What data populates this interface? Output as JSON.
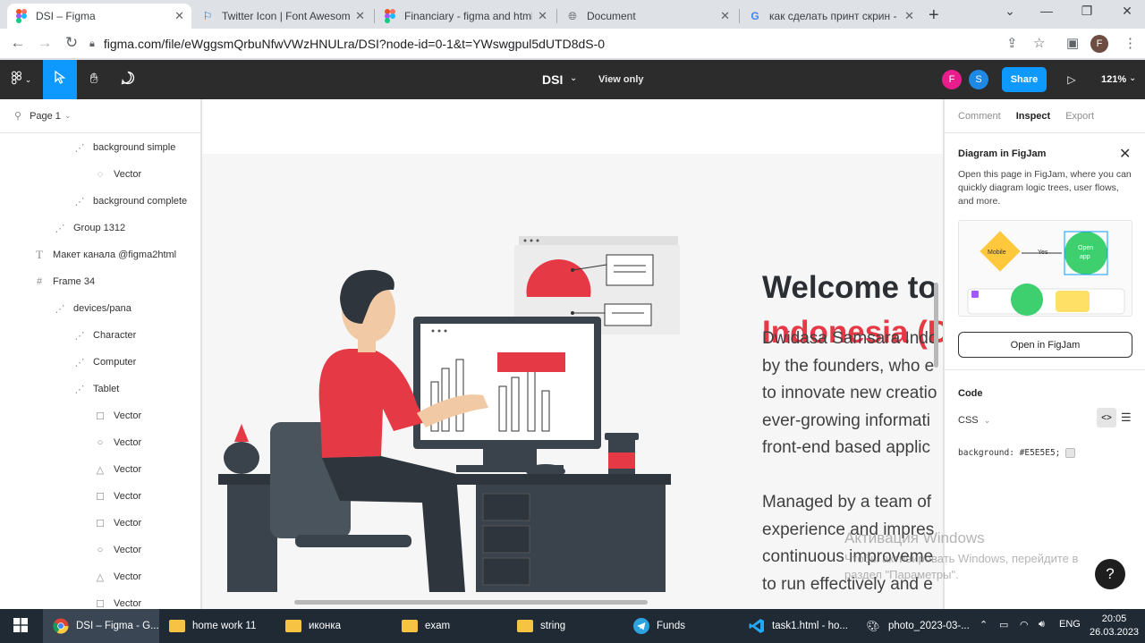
{
  "browser": {
    "tabs": [
      {
        "title": "DSI – Figma",
        "icon": "figma-icon",
        "active": true
      },
      {
        "title": "Twitter Icon | Font Awesome",
        "icon": "flag-icon",
        "active": false
      },
      {
        "title": "Financiary - figma and html f",
        "icon": "figma-icon",
        "active": false
      },
      {
        "title": "Document",
        "icon": "globe-icon",
        "active": false
      },
      {
        "title": "как сделать принт скрин - П",
        "icon": "google-icon",
        "active": false
      }
    ],
    "url": "figma.com/file/eWggsmQrbuNfwVWzHNULra/DSI?node-id=0-1&t=YWswgpul5dUTD8dS-0",
    "profile_initial": "F"
  },
  "figma": {
    "doc_name": "DSI",
    "view_only": "View only",
    "avatars": [
      {
        "initial": "F",
        "color": "#e91e8c"
      },
      {
        "initial": "S",
        "color": "#1e88e5"
      }
    ],
    "share_label": "Share",
    "zoom": "121%",
    "page_selector": "Page 1",
    "layers": [
      {
        "name": "background simple",
        "type": "group",
        "indent": 3
      },
      {
        "name": "Vector",
        "type": "vector",
        "indent": 4
      },
      {
        "name": "background complete",
        "type": "group",
        "indent": 3
      },
      {
        "name": "Group 1312",
        "type": "group",
        "indent": 2
      },
      {
        "name": "Макет канала @figma2html",
        "type": "text",
        "indent": 1
      },
      {
        "name": "Frame 34",
        "type": "frame",
        "indent": 1
      },
      {
        "name": "devices/pana",
        "type": "group",
        "indent": 2
      },
      {
        "name": "Character",
        "type": "group",
        "indent": 3
      },
      {
        "name": "Computer",
        "type": "group",
        "indent": 3
      },
      {
        "name": "Tablet",
        "type": "group",
        "indent": 3
      },
      {
        "name": "Vector",
        "type": "rect",
        "indent": 4
      },
      {
        "name": "Vector",
        "type": "ellipse",
        "indent": 4
      },
      {
        "name": "Vector",
        "type": "polygon",
        "indent": 4
      },
      {
        "name": "Vector",
        "type": "rect",
        "indent": 4
      },
      {
        "name": "Vector",
        "type": "rect",
        "indent": 4
      },
      {
        "name": "Vector",
        "type": "ellipse",
        "indent": 4
      },
      {
        "name": "Vector",
        "type": "polygon",
        "indent": 4
      },
      {
        "name": "Vector",
        "type": "rect",
        "indent": 4
      }
    ],
    "canvas": {
      "title_line1": "Welcome to",
      "title_line2": "Indonesia (D",
      "paragraph1": [
        "Dwidasa Samsara Indo",
        "by the founders, who e",
        "to innovate new creatio",
        "ever-growing informati",
        "front-end based applic"
      ],
      "paragraph2": [
        "Managed by a team of",
        "experience and impres",
        "continuous improveme",
        "to run effectively and e"
      ]
    },
    "right_panel": {
      "tabs": [
        {
          "label": "Comment",
          "active": false
        },
        {
          "label": "Inspect",
          "active": true
        },
        {
          "label": "Export",
          "active": false
        }
      ],
      "figjam_title": "Diagram in FigJam",
      "figjam_desc": "Open this page in FigJam, where you can quickly diagram logic trees, user flows, and more.",
      "figjam_preview": {
        "node1": "Mobile",
        "edge": "Yes",
        "node2_line1": "Open",
        "node2_line2": "app"
      },
      "figjam_button": "Open in FigJam",
      "code_title": "Code",
      "code_lang": "CSS",
      "code_value": "background: #E5E5E5;",
      "help": "?"
    }
  },
  "windows_watermark": {
    "line1": "Активация Windows",
    "line2": "Чтобы активировать Windows, перейдите в",
    "line3": "раздел \"Параметры\"."
  },
  "taskbar": {
    "items": [
      {
        "label": "DSI – Figma - G...",
        "icon": "chrome-icon",
        "active": true
      },
      {
        "label": "home work 11",
        "icon": "folder-icon"
      },
      {
        "label": "иконка",
        "icon": "folder-icon"
      },
      {
        "label": "exam",
        "icon": "folder-icon"
      },
      {
        "label": "string",
        "icon": "folder-icon"
      },
      {
        "label": "Funds",
        "icon": "telegram-icon"
      },
      {
        "label": "task1.html - ho...",
        "icon": "vscode-icon"
      },
      {
        "label": "photo_2023-03-...",
        "icon": "paint-icon"
      }
    ],
    "lang": "ENG",
    "time": "20:05",
    "date": "26.03.2023"
  }
}
